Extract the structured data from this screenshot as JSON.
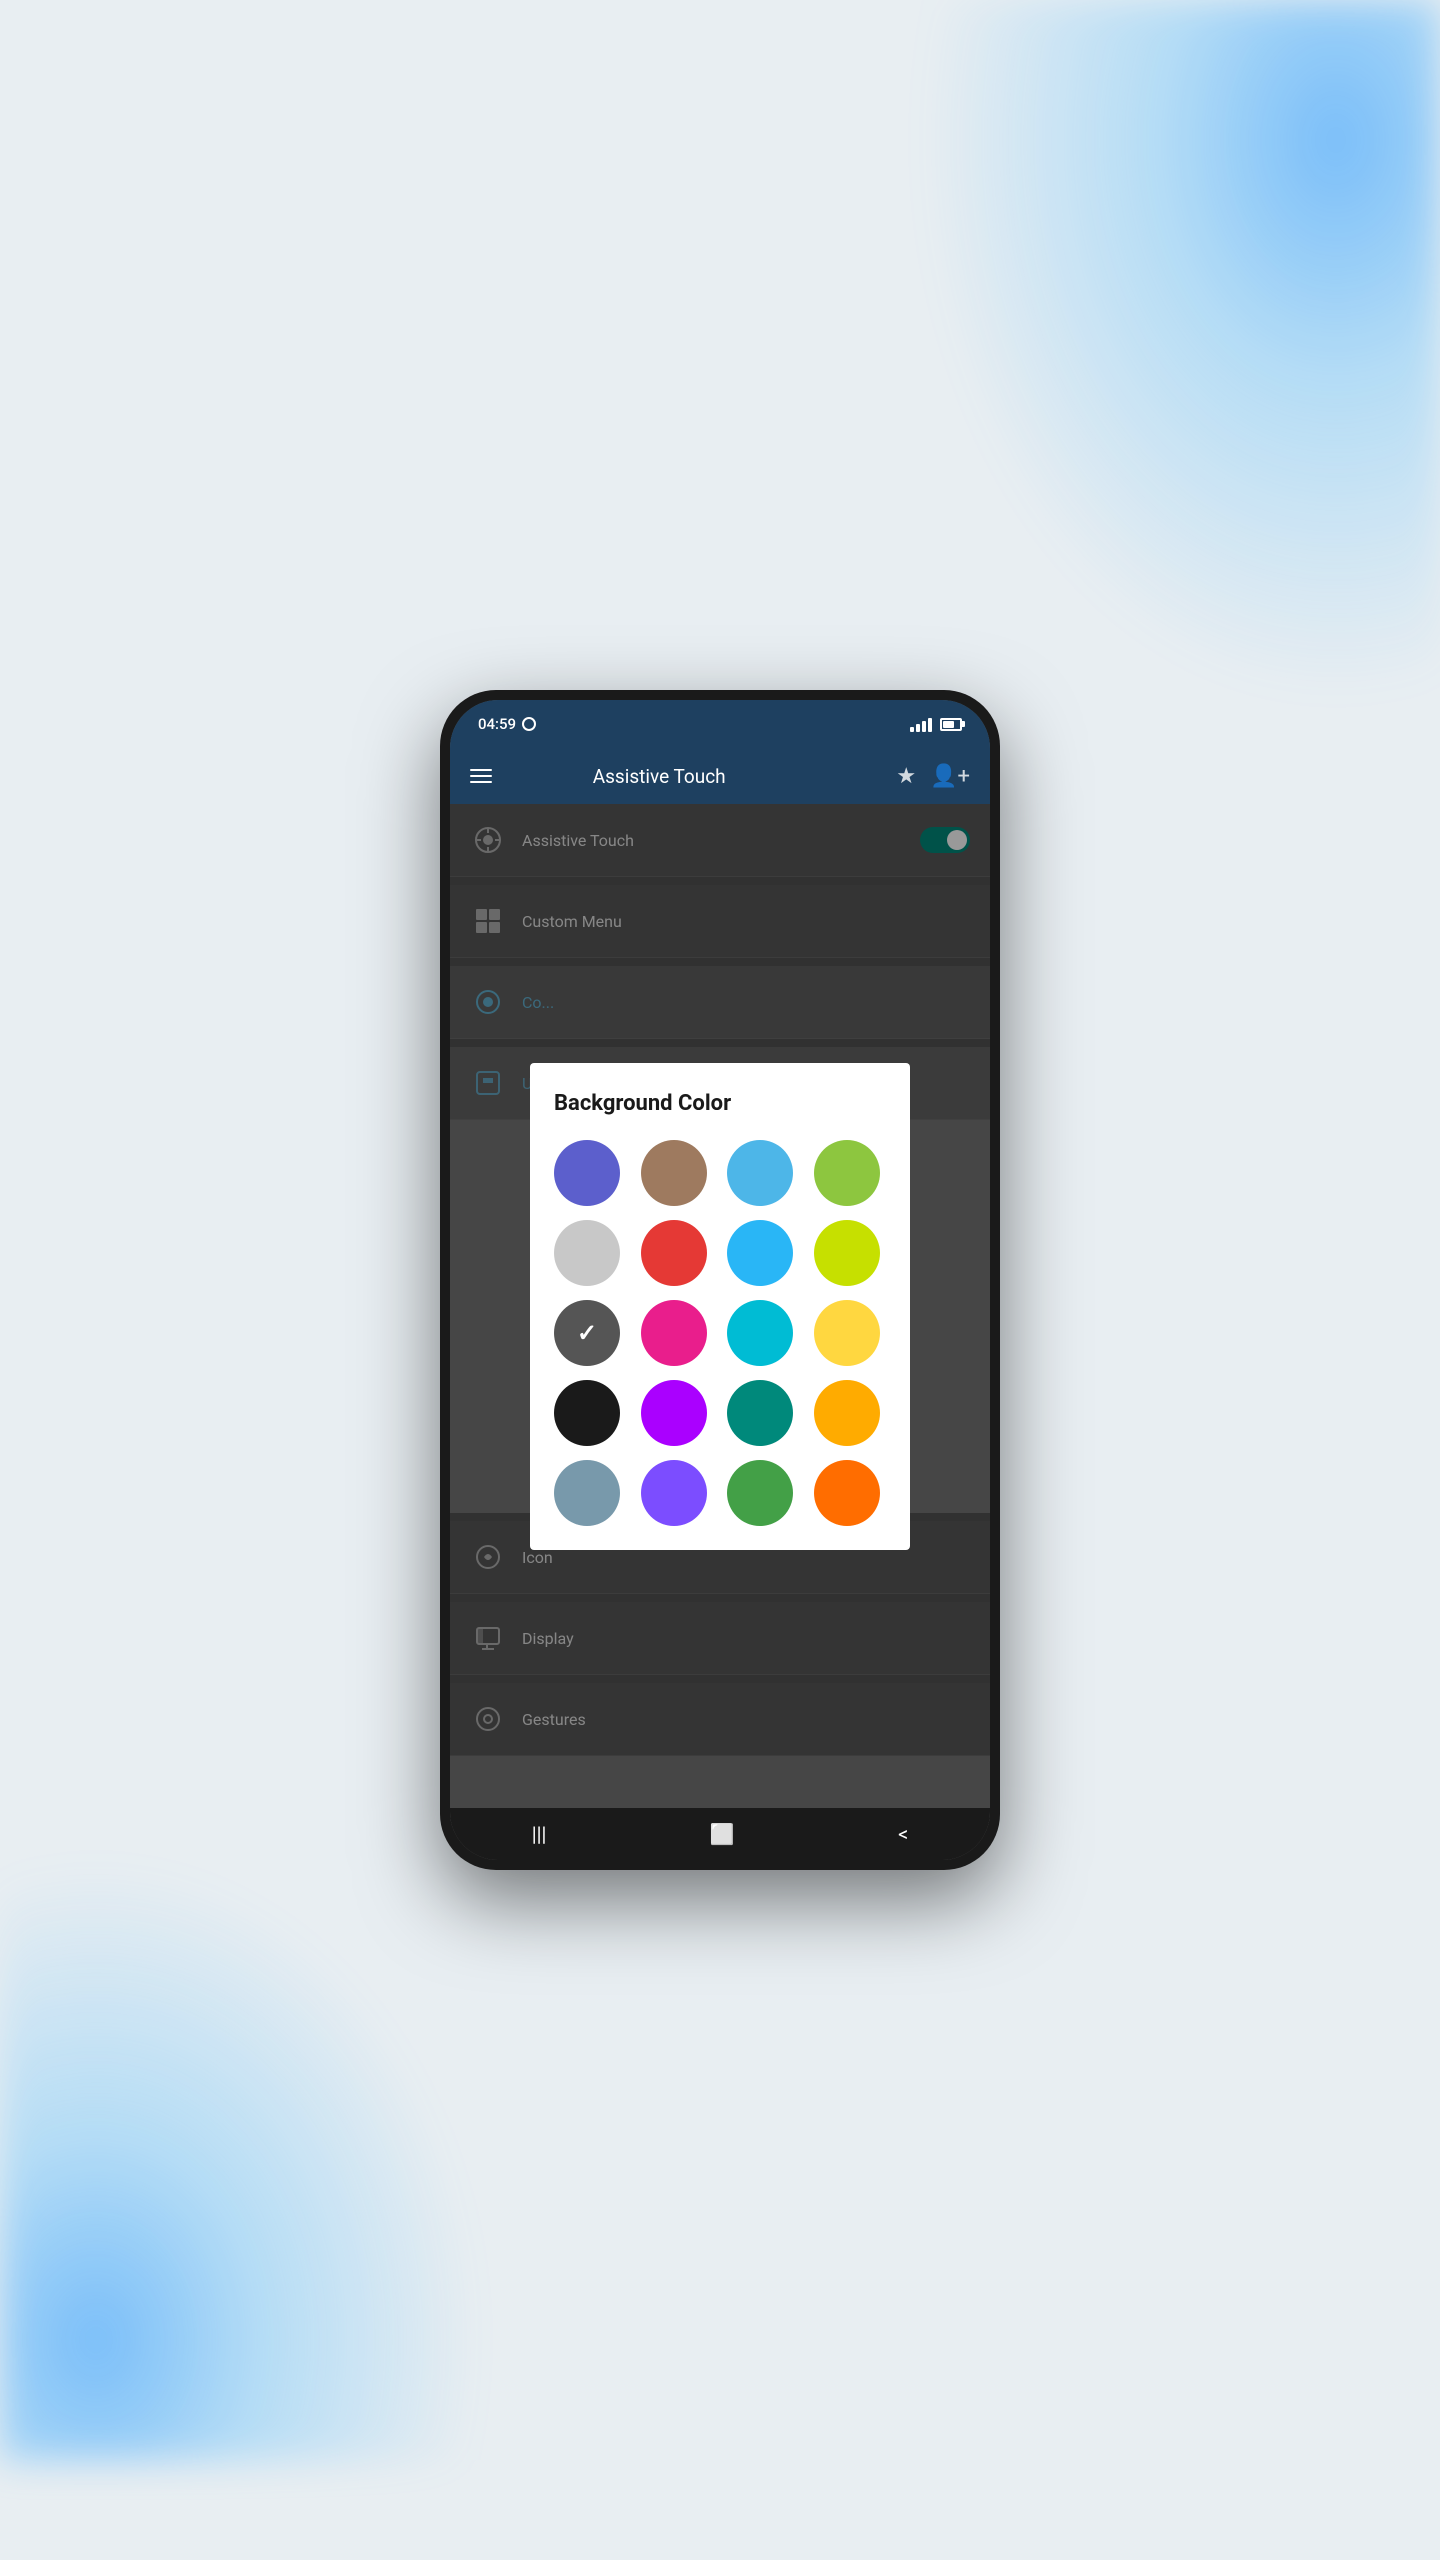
{
  "background": {
    "smokeColor": "#3ab4ff"
  },
  "statusBar": {
    "time": "04:59",
    "circleIcon": "○"
  },
  "appBar": {
    "title": "Assistive Touch",
    "hamburgerLabel": "menu",
    "starLabel": "favorite",
    "personAddLabel": "add person"
  },
  "settingsItems": [
    {
      "id": "assistive-touch",
      "label": "Assistive Touch",
      "icon": "assistive-touch-icon",
      "hasToggle": true,
      "toggleOn": true
    },
    {
      "id": "custom-menu",
      "label": "Custom Menu",
      "icon": "custom-menu-icon",
      "hasToggle": false
    }
  ],
  "belowDialogItems": [
    {
      "id": "icon",
      "label": "Icon",
      "icon": "icon-setting-icon",
      "color": "normal"
    },
    {
      "id": "display",
      "label": "Display",
      "icon": "display-icon",
      "color": "normal"
    },
    {
      "id": "gestures",
      "label": "Gestures",
      "icon": "gestures-icon",
      "color": "normal"
    }
  ],
  "dialog": {
    "title": "Background Color",
    "colors": [
      {
        "id": "indigo",
        "hex": "#5c5fcc",
        "selected": false
      },
      {
        "id": "brown",
        "hex": "#9e7a5f",
        "selected": false
      },
      {
        "id": "blue",
        "hex": "#4db6e8",
        "selected": false
      },
      {
        "id": "lime",
        "hex": "#8dc63f",
        "selected": false
      },
      {
        "id": "gray",
        "hex": "#c8c8c8",
        "selected": false
      },
      {
        "id": "red",
        "hex": "#e53935",
        "selected": false
      },
      {
        "id": "sky-blue",
        "hex": "#29b6f6",
        "selected": false
      },
      {
        "id": "yellow-green",
        "hex": "#c6e000",
        "selected": false
      },
      {
        "id": "dark-gray",
        "hex": "#555555",
        "selected": true
      },
      {
        "id": "pink",
        "hex": "#e91e8c",
        "selected": false
      },
      {
        "id": "cyan",
        "hex": "#00bcd4",
        "selected": false
      },
      {
        "id": "yellow",
        "hex": "#ffd740",
        "selected": false
      },
      {
        "id": "black",
        "hex": "#1a1a1a",
        "selected": false
      },
      {
        "id": "purple",
        "hex": "#aa00ff",
        "selected": false
      },
      {
        "id": "teal",
        "hex": "#00897b",
        "selected": false
      },
      {
        "id": "amber",
        "hex": "#ffab00",
        "selected": false
      },
      {
        "id": "steel-blue",
        "hex": "#7899ab",
        "selected": false
      },
      {
        "id": "violet",
        "hex": "#7c4dff",
        "selected": false
      },
      {
        "id": "green",
        "hex": "#43a047",
        "selected": false
      },
      {
        "id": "orange",
        "hex": "#ff6d00",
        "selected": false
      }
    ]
  },
  "bottomNav": {
    "menuBtn": "|||",
    "homeBtn": "⬜",
    "backBtn": "<"
  },
  "hiddenItems": [
    {
      "id": "color-settings",
      "label": "Co...",
      "color": "blue"
    },
    {
      "id": "update-section",
      "label": "Upc...",
      "color": "blue"
    }
  ]
}
